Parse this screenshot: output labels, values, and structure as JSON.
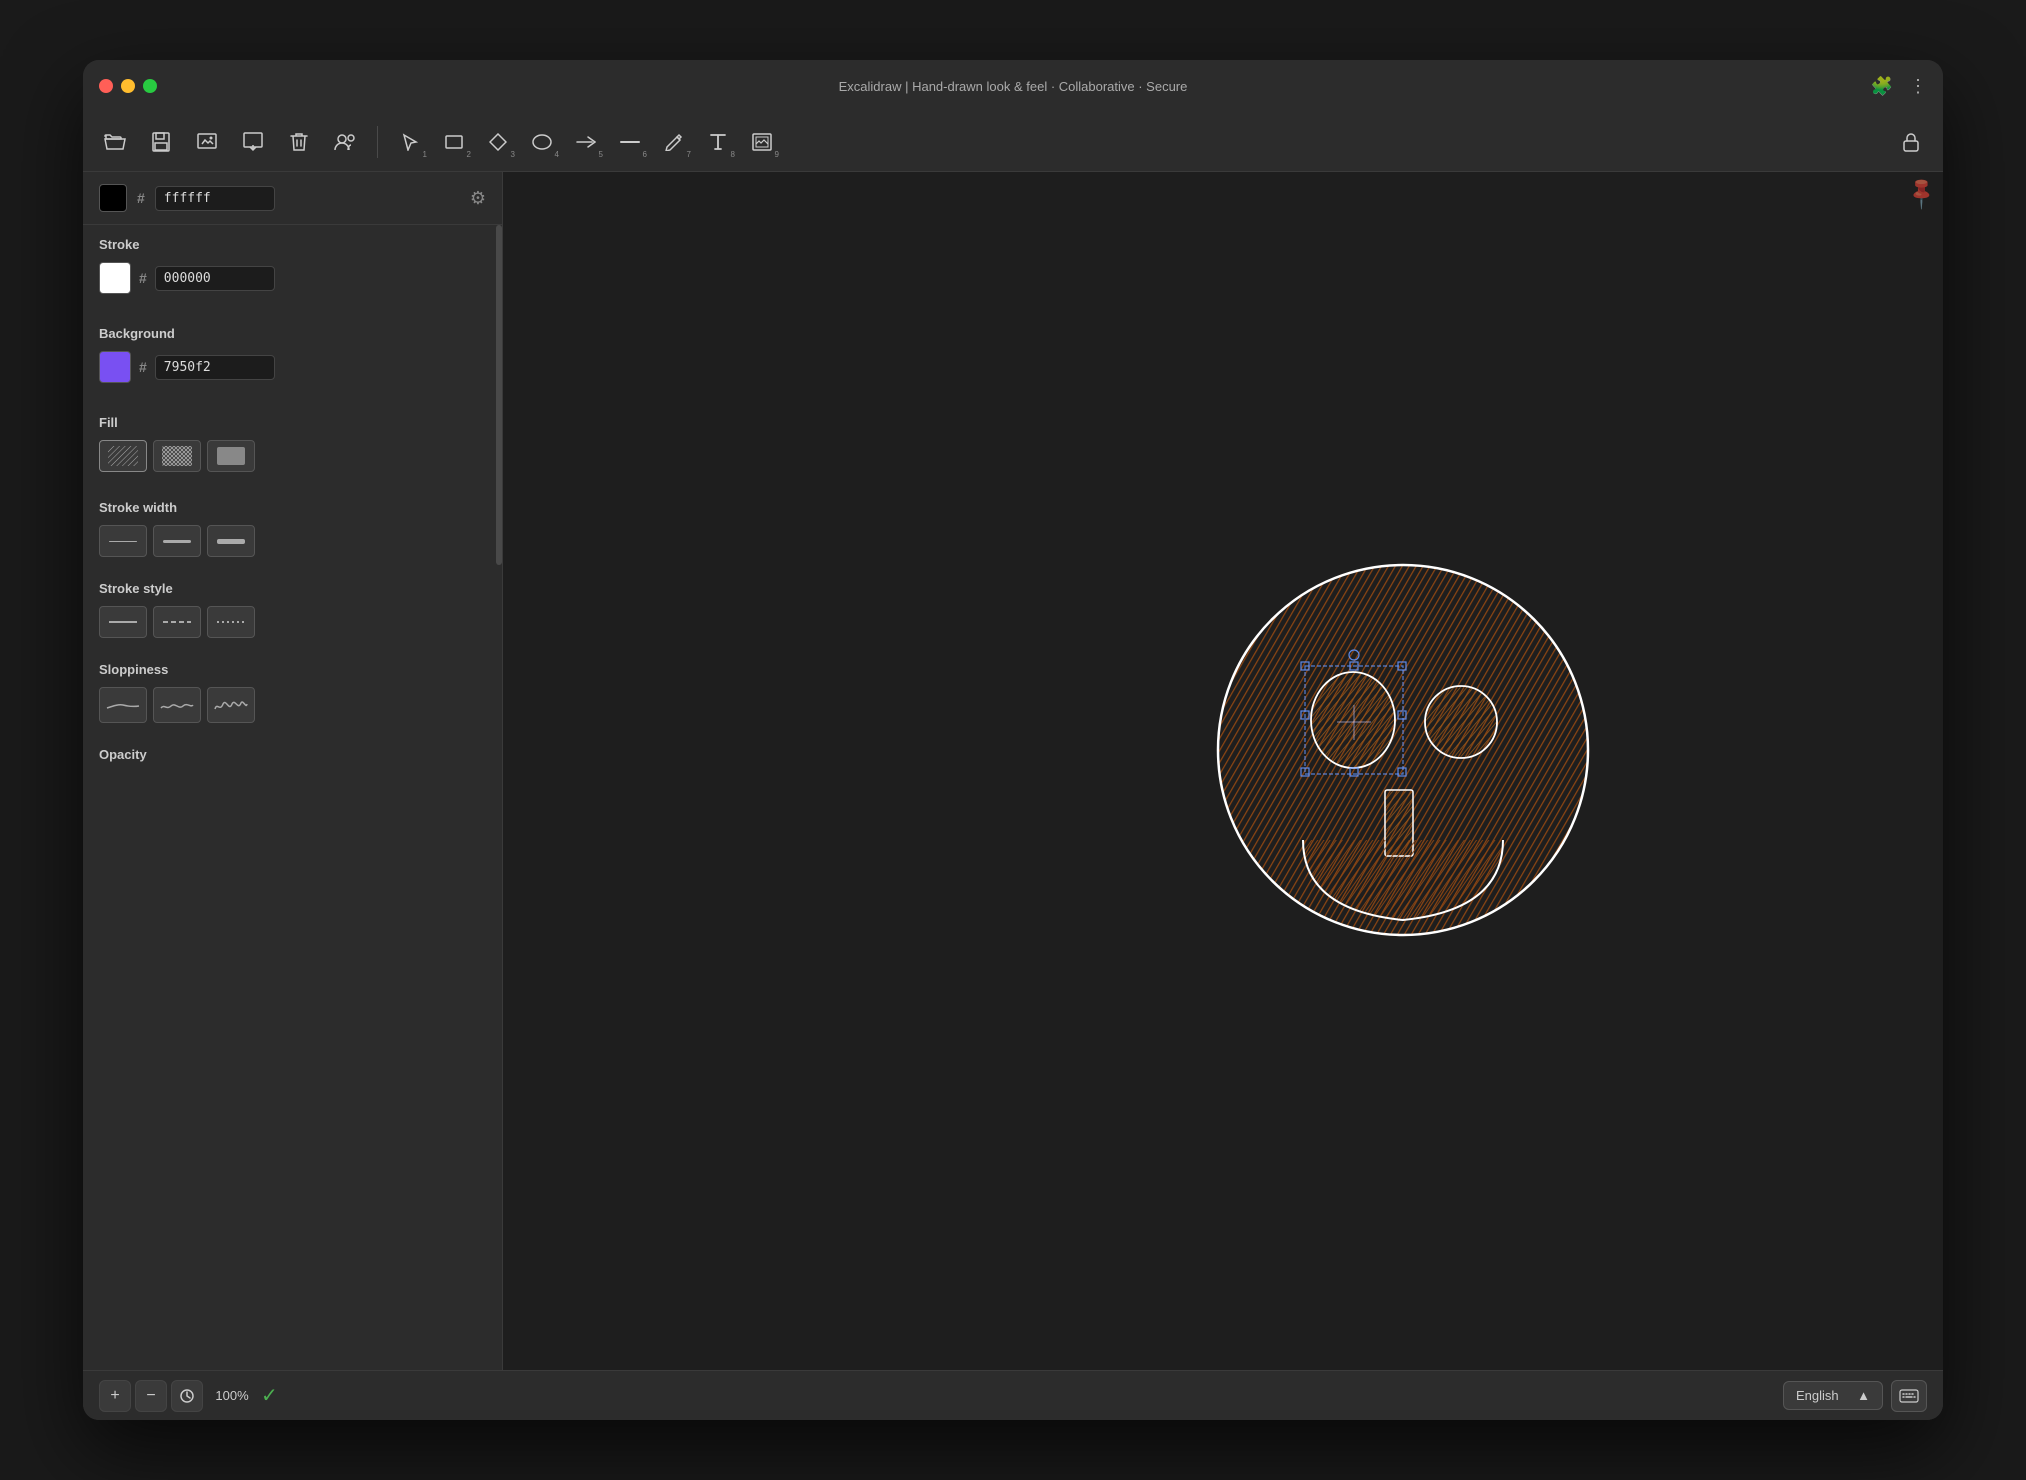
{
  "window": {
    "title": "Excalidraw | Hand-drawn look & feel · Collaborative · Secure"
  },
  "titlebar": {
    "title": "Excalidraw | Hand-drawn look & feel · Collaborative · Secure"
  },
  "toolbar": {
    "left_tools": [
      {
        "name": "open",
        "icon": "📂",
        "label": "Open"
      },
      {
        "name": "save",
        "icon": "💾",
        "label": "Save"
      },
      {
        "name": "export-image",
        "icon": "🖼",
        "label": "Export Image"
      },
      {
        "name": "export",
        "icon": "📤",
        "label": "Export"
      },
      {
        "name": "delete",
        "icon": "🗑",
        "label": "Delete"
      },
      {
        "name": "collaborate",
        "icon": "👥",
        "label": "Collaborate"
      }
    ],
    "center_tools": [
      {
        "name": "select",
        "icon": "↖",
        "number": "1"
      },
      {
        "name": "rectangle",
        "icon": "⬜",
        "number": "2"
      },
      {
        "name": "diamond",
        "icon": "◇",
        "number": "3"
      },
      {
        "name": "ellipse",
        "icon": "⬭",
        "number": "4"
      },
      {
        "name": "arrow",
        "icon": "→",
        "number": "5"
      },
      {
        "name": "line",
        "icon": "—",
        "number": "6"
      },
      {
        "name": "pencil",
        "icon": "✏",
        "number": "7"
      },
      {
        "name": "text",
        "icon": "A",
        "number": "8"
      },
      {
        "name": "image",
        "icon": "⊞",
        "number": "9"
      }
    ],
    "right_tools": [
      {
        "name": "lock",
        "icon": "🔓"
      }
    ]
  },
  "properties": {
    "quick_color": {
      "swatch": "#000000",
      "hash": "#",
      "value": "ffffff",
      "gear": "⚙"
    },
    "stroke": {
      "label": "Stroke",
      "swatch": "#ffffff",
      "hash": "#",
      "value": "000000"
    },
    "background": {
      "label": "Background",
      "swatch": "#7950f2",
      "hash": "#",
      "value": "7950f2"
    },
    "fill": {
      "label": "Fill",
      "options": [
        "hatch",
        "crosshatch",
        "solid"
      ]
    },
    "stroke_width": {
      "label": "Stroke width",
      "options": [
        "thin",
        "medium",
        "thick"
      ]
    },
    "stroke_style": {
      "label": "Stroke style",
      "options": [
        "solid",
        "dashed",
        "dotted"
      ]
    },
    "sloppiness": {
      "label": "Sloppiness",
      "options": [
        "low",
        "medium",
        "high"
      ]
    },
    "opacity": {
      "label": "Opacity"
    }
  },
  "bottom": {
    "zoom_minus": "−",
    "zoom_plus": "+",
    "zoom_reset_icon": "⟳",
    "zoom_level": "100%",
    "status_icon": "✓",
    "language": "English",
    "language_arrow": "▲",
    "keyboard_icon": "⌨"
  }
}
